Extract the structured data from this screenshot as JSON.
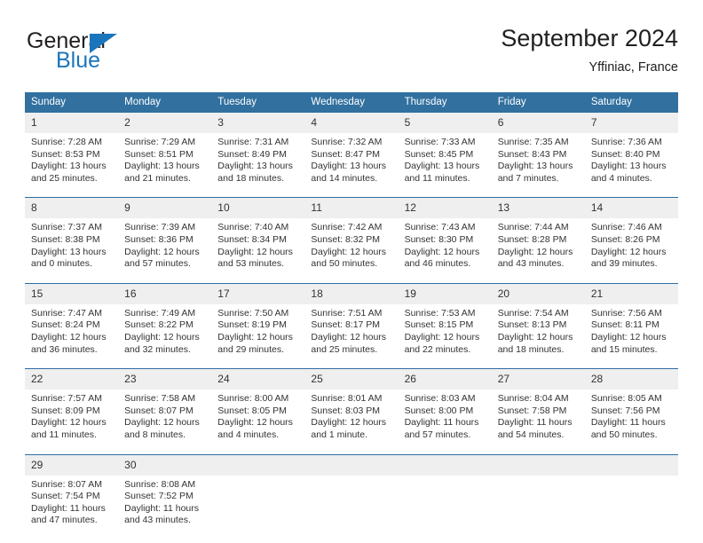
{
  "brand": {
    "name_top": "General",
    "name_bottom": "Blue",
    "accent_color": "#1b75bb"
  },
  "header": {
    "title": "September 2024",
    "location": "Yffiniac, France"
  },
  "calendar": {
    "header_color": "#31709f",
    "daynum_band_color": "#efefef",
    "weekdays": [
      "Sunday",
      "Monday",
      "Tuesday",
      "Wednesday",
      "Thursday",
      "Friday",
      "Saturday"
    ],
    "weeks": [
      [
        {
          "day": "1",
          "sunrise": "Sunrise: 7:28 AM",
          "sunset": "Sunset: 8:53 PM",
          "daylight_1": "Daylight: 13 hours",
          "daylight_2": "and 25 minutes."
        },
        {
          "day": "2",
          "sunrise": "Sunrise: 7:29 AM",
          "sunset": "Sunset: 8:51 PM",
          "daylight_1": "Daylight: 13 hours",
          "daylight_2": "and 21 minutes."
        },
        {
          "day": "3",
          "sunrise": "Sunrise: 7:31 AM",
          "sunset": "Sunset: 8:49 PM",
          "daylight_1": "Daylight: 13 hours",
          "daylight_2": "and 18 minutes."
        },
        {
          "day": "4",
          "sunrise": "Sunrise: 7:32 AM",
          "sunset": "Sunset: 8:47 PM",
          "daylight_1": "Daylight: 13 hours",
          "daylight_2": "and 14 minutes."
        },
        {
          "day": "5",
          "sunrise": "Sunrise: 7:33 AM",
          "sunset": "Sunset: 8:45 PM",
          "daylight_1": "Daylight: 13 hours",
          "daylight_2": "and 11 minutes."
        },
        {
          "day": "6",
          "sunrise": "Sunrise: 7:35 AM",
          "sunset": "Sunset: 8:43 PM",
          "daylight_1": "Daylight: 13 hours",
          "daylight_2": "and 7 minutes."
        },
        {
          "day": "7",
          "sunrise": "Sunrise: 7:36 AM",
          "sunset": "Sunset: 8:40 PM",
          "daylight_1": "Daylight: 13 hours",
          "daylight_2": "and 4 minutes."
        }
      ],
      [
        {
          "day": "8",
          "sunrise": "Sunrise: 7:37 AM",
          "sunset": "Sunset: 8:38 PM",
          "daylight_1": "Daylight: 13 hours",
          "daylight_2": "and 0 minutes."
        },
        {
          "day": "9",
          "sunrise": "Sunrise: 7:39 AM",
          "sunset": "Sunset: 8:36 PM",
          "daylight_1": "Daylight: 12 hours",
          "daylight_2": "and 57 minutes."
        },
        {
          "day": "10",
          "sunrise": "Sunrise: 7:40 AM",
          "sunset": "Sunset: 8:34 PM",
          "daylight_1": "Daylight: 12 hours",
          "daylight_2": "and 53 minutes."
        },
        {
          "day": "11",
          "sunrise": "Sunrise: 7:42 AM",
          "sunset": "Sunset: 8:32 PM",
          "daylight_1": "Daylight: 12 hours",
          "daylight_2": "and 50 minutes."
        },
        {
          "day": "12",
          "sunrise": "Sunrise: 7:43 AM",
          "sunset": "Sunset: 8:30 PM",
          "daylight_1": "Daylight: 12 hours",
          "daylight_2": "and 46 minutes."
        },
        {
          "day": "13",
          "sunrise": "Sunrise: 7:44 AM",
          "sunset": "Sunset: 8:28 PM",
          "daylight_1": "Daylight: 12 hours",
          "daylight_2": "and 43 minutes."
        },
        {
          "day": "14",
          "sunrise": "Sunrise: 7:46 AM",
          "sunset": "Sunset: 8:26 PM",
          "daylight_1": "Daylight: 12 hours",
          "daylight_2": "and 39 minutes."
        }
      ],
      [
        {
          "day": "15",
          "sunrise": "Sunrise: 7:47 AM",
          "sunset": "Sunset: 8:24 PM",
          "daylight_1": "Daylight: 12 hours",
          "daylight_2": "and 36 minutes."
        },
        {
          "day": "16",
          "sunrise": "Sunrise: 7:49 AM",
          "sunset": "Sunset: 8:22 PM",
          "daylight_1": "Daylight: 12 hours",
          "daylight_2": "and 32 minutes."
        },
        {
          "day": "17",
          "sunrise": "Sunrise: 7:50 AM",
          "sunset": "Sunset: 8:19 PM",
          "daylight_1": "Daylight: 12 hours",
          "daylight_2": "and 29 minutes."
        },
        {
          "day": "18",
          "sunrise": "Sunrise: 7:51 AM",
          "sunset": "Sunset: 8:17 PM",
          "daylight_1": "Daylight: 12 hours",
          "daylight_2": "and 25 minutes."
        },
        {
          "day": "19",
          "sunrise": "Sunrise: 7:53 AM",
          "sunset": "Sunset: 8:15 PM",
          "daylight_1": "Daylight: 12 hours",
          "daylight_2": "and 22 minutes."
        },
        {
          "day": "20",
          "sunrise": "Sunrise: 7:54 AM",
          "sunset": "Sunset: 8:13 PM",
          "daylight_1": "Daylight: 12 hours",
          "daylight_2": "and 18 minutes."
        },
        {
          "day": "21",
          "sunrise": "Sunrise: 7:56 AM",
          "sunset": "Sunset: 8:11 PM",
          "daylight_1": "Daylight: 12 hours",
          "daylight_2": "and 15 minutes."
        }
      ],
      [
        {
          "day": "22",
          "sunrise": "Sunrise: 7:57 AM",
          "sunset": "Sunset: 8:09 PM",
          "daylight_1": "Daylight: 12 hours",
          "daylight_2": "and 11 minutes."
        },
        {
          "day": "23",
          "sunrise": "Sunrise: 7:58 AM",
          "sunset": "Sunset: 8:07 PM",
          "daylight_1": "Daylight: 12 hours",
          "daylight_2": "and 8 minutes."
        },
        {
          "day": "24",
          "sunrise": "Sunrise: 8:00 AM",
          "sunset": "Sunset: 8:05 PM",
          "daylight_1": "Daylight: 12 hours",
          "daylight_2": "and 4 minutes."
        },
        {
          "day": "25",
          "sunrise": "Sunrise: 8:01 AM",
          "sunset": "Sunset: 8:03 PM",
          "daylight_1": "Daylight: 12 hours",
          "daylight_2": "and 1 minute."
        },
        {
          "day": "26",
          "sunrise": "Sunrise: 8:03 AM",
          "sunset": "Sunset: 8:00 PM",
          "daylight_1": "Daylight: 11 hours",
          "daylight_2": "and 57 minutes."
        },
        {
          "day": "27",
          "sunrise": "Sunrise: 8:04 AM",
          "sunset": "Sunset: 7:58 PM",
          "daylight_1": "Daylight: 11 hours",
          "daylight_2": "and 54 minutes."
        },
        {
          "day": "28",
          "sunrise": "Sunrise: 8:05 AM",
          "sunset": "Sunset: 7:56 PM",
          "daylight_1": "Daylight: 11 hours",
          "daylight_2": "and 50 minutes."
        }
      ],
      [
        {
          "day": "29",
          "sunrise": "Sunrise: 8:07 AM",
          "sunset": "Sunset: 7:54 PM",
          "daylight_1": "Daylight: 11 hours",
          "daylight_2": "and 47 minutes."
        },
        {
          "day": "30",
          "sunrise": "Sunrise: 8:08 AM",
          "sunset": "Sunset: 7:52 PM",
          "daylight_1": "Daylight: 11 hours",
          "daylight_2": "and 43 minutes."
        },
        {
          "day": "",
          "sunrise": "",
          "sunset": "",
          "daylight_1": "",
          "daylight_2": ""
        },
        {
          "day": "",
          "sunrise": "",
          "sunset": "",
          "daylight_1": "",
          "daylight_2": ""
        },
        {
          "day": "",
          "sunrise": "",
          "sunset": "",
          "daylight_1": "",
          "daylight_2": ""
        },
        {
          "day": "",
          "sunrise": "",
          "sunset": "",
          "daylight_1": "",
          "daylight_2": ""
        },
        {
          "day": "",
          "sunrise": "",
          "sunset": "",
          "daylight_1": "",
          "daylight_2": ""
        }
      ]
    ]
  }
}
